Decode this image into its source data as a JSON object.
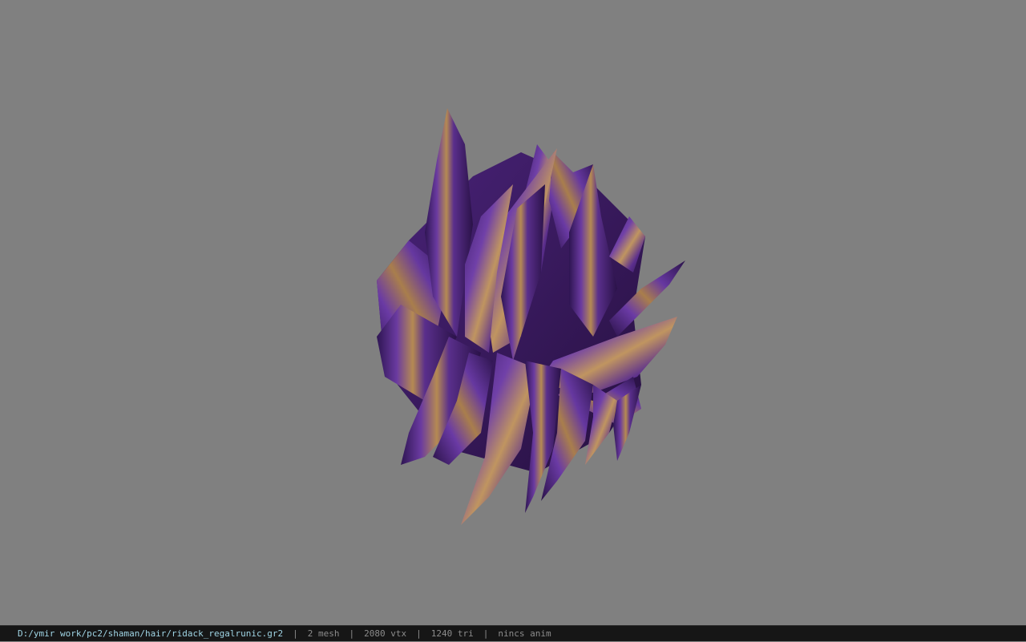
{
  "viewport": {
    "background_color": "#808080",
    "model_description_icon": "hair-model-icon"
  },
  "status_bar": {
    "file_path": "D:/ymir work/pc2/shaman/hair/ridack_regalrunic.gr2",
    "separator": "|",
    "mesh_count": "2 mesh",
    "vertex_count": "2080 vtx",
    "triangle_count": "1240 tri",
    "animation": "nincs anim"
  },
  "colors": {
    "hair_purple": "#5a2f8c",
    "hair_dark_purple": "#2e1552",
    "hair_gold": "#b58a52",
    "status_path": "#9fd4e4",
    "status_text": "#8c8c8c"
  }
}
